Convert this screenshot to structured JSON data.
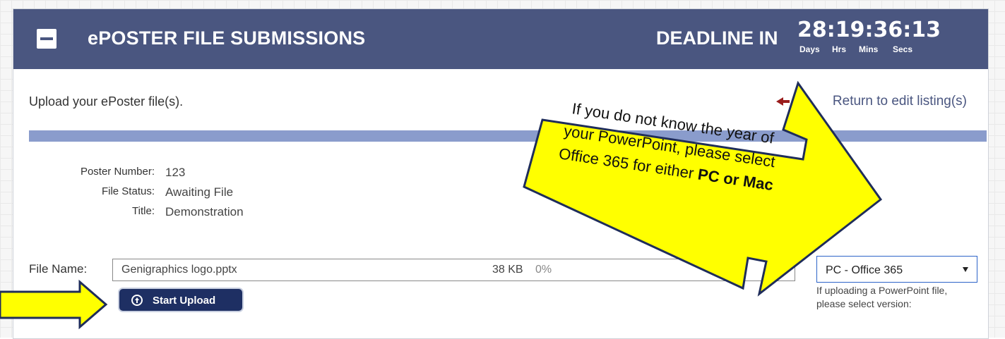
{
  "header": {
    "title": "ePOSTER FILE SUBMISSIONS",
    "deadline_label": "DEADLINE IN",
    "countdown": "28:19:36:13",
    "labels": {
      "days": "Days",
      "hrs": "Hrs",
      "mins": "Mins",
      "secs": "Secs"
    }
  },
  "upload_heading": "Upload your ePoster file(s).",
  "return_link": "Return to edit listing(s)",
  "poster_info": [
    {
      "label": "Poster Number:",
      "value": "123"
    },
    {
      "label": "File Status:",
      "value": "Awaiting File"
    },
    {
      "label": "Title:",
      "value": "Demonstration"
    }
  ],
  "file": {
    "label": "File Name:",
    "name": "Genigraphics logo.pptx",
    "size": "38 KB",
    "progress_text": "0%",
    "progress_fraction": 0
  },
  "start_upload_label": "Start Upload",
  "version": {
    "selected": "PC - Office 365",
    "help": "If uploading a PowerPoint file, please select version:"
  },
  "callout": {
    "line1": "If you do not know the year of",
    "line2": "your PowerPoint, please select",
    "line3_prefix": "Office 365 for either ",
    "line3_bold": "PC or Mac"
  },
  "colors": {
    "header": "#4a5680",
    "button": "#1e2f63",
    "strip": "#8a9ccc",
    "arrow": "#ffff00",
    "arrow_border": "#1f2d5a",
    "back_arrow": "#9a1c1c"
  },
  "icons": [
    "collapse-icon",
    "back-arrow-icon",
    "upload-icon",
    "chevron-down-icon",
    "callout-arrow",
    "pointer-arrow"
  ]
}
